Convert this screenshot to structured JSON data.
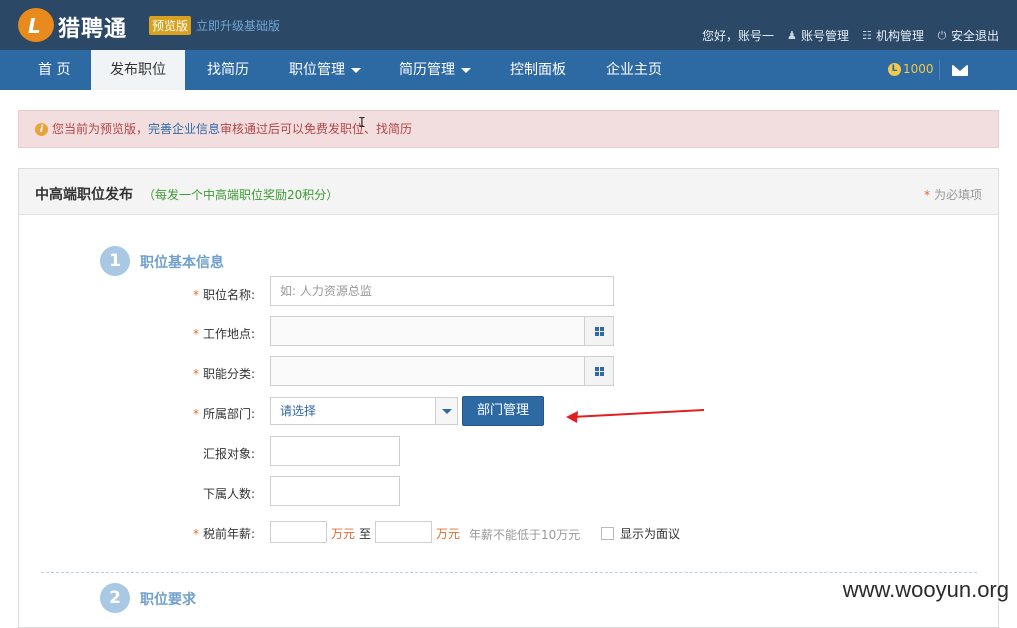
{
  "header": {
    "brand": "猎聘通",
    "badge": "预览版",
    "upgrade_link": "立即升级基础版",
    "greeting": "您好，账号一",
    "account_label": "账号管理",
    "org_label": "机构管理",
    "logout_label": "安全退出"
  },
  "nav": {
    "items": [
      "首 页",
      "发布职位",
      "找简历",
      "职位管理",
      "简历管理",
      "控制面板",
      "企业主页"
    ],
    "coins": "1000"
  },
  "alert": {
    "prefix": "您当前为预览版，",
    "link": "完善企业信息",
    "suffix": "审核通过后可以免费发职位、找简历"
  },
  "panel": {
    "title": "中高端职位发布",
    "subtitle": "（每发一个中高端职位奖励20积分）",
    "required_note": "为必填项"
  },
  "steps": [
    {
      "number": "1",
      "title": "职位基本信息"
    },
    {
      "number": "2",
      "title": "职位要求"
    }
  ],
  "form": {
    "job_title_label": "职位名称:",
    "job_title_placeholder": "如: 人力资源总监",
    "location_label": "工作地点:",
    "category_label": "职能分类:",
    "department_label": "所属部门:",
    "department_value": "请选择",
    "department_button": "部门管理",
    "report_to_label": "汇报对象:",
    "subordinates_label": "下属人数:",
    "salary_label": "税前年薪:",
    "salary_unit": "万元",
    "salary_to": "至",
    "salary_hint": "年薪不能低于10万元",
    "salary_negotiable": "显示为面议"
  },
  "watermark": "www.wooyun.org",
  "colors": {
    "topbar": "#2b4866",
    "navbar": "#2d6aa3",
    "alert_bg": "#f2dede",
    "required_star": "#e36c2f",
    "annotation_arrow": "#e02020"
  }
}
